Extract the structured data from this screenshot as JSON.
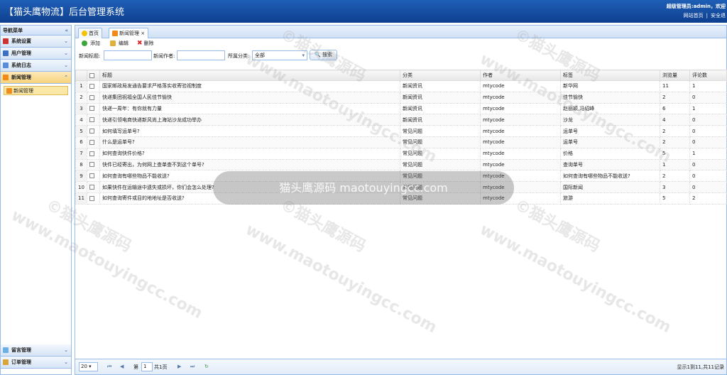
{
  "header": {
    "title": "【猫头鹰物流】后台管理系统",
    "user_text": "超级管理员:admin，欢迎",
    "link_home": "网站首页",
    "link_logout": "安全退"
  },
  "sidebar": {
    "title": "导航菜单",
    "panels": [
      {
        "label": "系统设置",
        "icon": "wrench-icon"
      },
      {
        "label": "用户管理",
        "icon": "users-icon"
      },
      {
        "label": "系统日志",
        "icon": "log-icon"
      },
      {
        "label": "新闻管理",
        "icon": "rss-icon"
      }
    ],
    "active_item": "新闻管理",
    "bottom_panels": [
      {
        "label": "留言管理",
        "icon": "comment-icon"
      },
      {
        "label": "订单管理",
        "icon": "order-icon"
      }
    ]
  },
  "tabs": [
    {
      "label": "首页"
    },
    {
      "label": "新闻管理"
    }
  ],
  "toolbar": {
    "add": "添加",
    "edit": "编辑",
    "delete": "删除"
  },
  "search": {
    "title_label": "新闻标题:",
    "author_label": "新闻作者:",
    "category_label": "所属分类:",
    "category_value": "全部",
    "button": "搜索"
  },
  "grid": {
    "columns": [
      "标题",
      "分类",
      "作者",
      "标签",
      "浏览量",
      "评论数"
    ],
    "rows": [
      {
        "n": "1",
        "title": "国家邮政局发通告要求严格落实收寄验视制度",
        "cat": "新闻资讯",
        "author": "mtycode",
        "tag": "新华网",
        "views": "11",
        "comments": "1"
      },
      {
        "n": "2",
        "title": "快递集团祝福全国人民佳节愉快",
        "cat": "新闻资讯",
        "author": "mtycode",
        "tag": "佳节愉快",
        "views": "2",
        "comments": "0"
      },
      {
        "n": "3",
        "title": "快递一周年：有你就有力量",
        "cat": "新闻资讯",
        "author": "mtycode",
        "tag": "赵丽颖,冯绍峰",
        "views": "6",
        "comments": "1"
      },
      {
        "n": "4",
        "title": "快递引领电商快递新风尚上海站沙龙成功举办",
        "cat": "新闻资讯",
        "author": "mtycode",
        "tag": "沙龙",
        "views": "4",
        "comments": "0"
      },
      {
        "n": "5",
        "title": "如何填写运单号?",
        "cat": "常见问题",
        "author": "mtycode",
        "tag": "运单号",
        "views": "2",
        "comments": "0"
      },
      {
        "n": "6",
        "title": "什么是运单号?",
        "cat": "常见问题",
        "author": "mtycode",
        "tag": "运单号",
        "views": "2",
        "comments": "0"
      },
      {
        "n": "7",
        "title": "如何查询快件价格?",
        "cat": "常见问题",
        "author": "mtycode",
        "tag": "价格",
        "views": "5",
        "comments": "1"
      },
      {
        "n": "8",
        "title": "快件已经寄出，为何网上查单查不到这个单号?",
        "cat": "常见问题",
        "author": "mtycode",
        "tag": "查询单号",
        "views": "1",
        "comments": "0"
      },
      {
        "n": "9",
        "title": "如何查询有哪些物品不能收送?",
        "cat": "常见问题",
        "author": "mtycode",
        "tag": "如何查询有哪些物品不能收送?",
        "views": "2",
        "comments": "0"
      },
      {
        "n": "10",
        "title": "如果快件在运输途中遗失或损坏，你们会怎么处理?",
        "cat": "常见问题",
        "author": "mtycode",
        "tag": "国际新闻",
        "views": "3",
        "comments": "0"
      },
      {
        "n": "11",
        "title": "如何查询寄件或目的地地址是否收送?",
        "cat": "常见问题",
        "author": "mtycode",
        "tag": "旅游",
        "views": "5",
        "comments": "2"
      }
    ]
  },
  "pager": {
    "page_size": "20",
    "page_label": "第",
    "page_value": "1",
    "total_pages": "共1页",
    "summary": "显示1到11,共11记录"
  },
  "watermark": {
    "overlay": "猫头鹰源码 maotouyingcc.com",
    "text1": "©猫头鹰源码",
    "text2": "www.maotouyingcc.com"
  }
}
